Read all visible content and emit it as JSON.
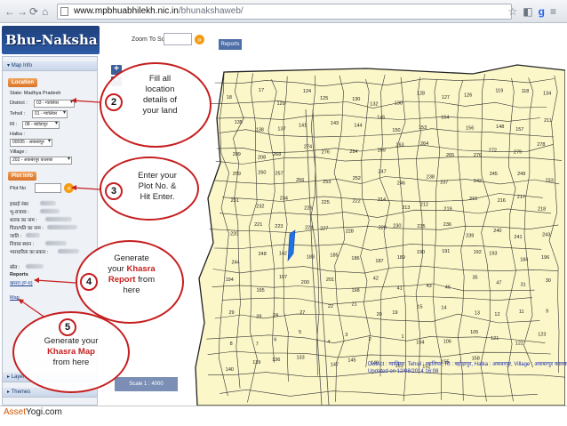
{
  "browser": {
    "url_domain": "www.mpbhuabhilekh.nic.in",
    "url_path": "/bhunakshaweb/",
    "url_prefix": "",
    "back_icon": "back-arrow-icon",
    "forward_icon": "forward-arrow-icon",
    "reload_icon": "reload-icon",
    "home_icon": "home-icon"
  },
  "header": {
    "logo": "Bhu-Naksha",
    "zoom_label": "Zoom To Scale:",
    "reports_label": "Reports"
  },
  "sidebar": {
    "map_info_title": "Map Info",
    "location_tag": "Location",
    "state_label": "State: Madhya Pradesh",
    "district_label": "District :",
    "district_value": "03 - ग्वालियर",
    "tehsil_label": "Tehsil :",
    "tehsil_value": "01 - ग्वालियर",
    "ri_label": "RI :",
    "ri_value": "08 - बहोड़ापुर",
    "halka_label": "Halka :",
    "halka_value": "00095 - अकबरपुर",
    "village_label": "Village :",
    "village_value": "202 - अकबरपुर कालका",
    "plot_info_tag": "Plot Info",
    "plot_no_label": "Plot No",
    "fields": [
      {
        "label": "इकाई नंबर"
      },
      {
        "label": "भू-राजस्व :"
      },
      {
        "label": "धारक का नाम :"
      },
      {
        "label": "पिता/पति का नाम :"
      },
      {
        "label": "जाति :"
      },
      {
        "label": "निवास स्थान :"
      },
      {
        "label": "भारधारिता का प्रकार :"
      }
    ],
    "shrot_label": "स्रोत :",
    "reports_heading": "Reports",
    "khasra_link": "खसरा (P-II)",
    "map_link": "Map",
    "layers_label": "Layers",
    "themes_label": "Themes"
  },
  "map": {
    "zoom_in": "+",
    "zoom_out": "−",
    "scale": "Scale 1 : 4000",
    "info_line1": "District : ग्वालियर, Tehsil : ग्वालियर, RI : बहोड़ापुर, Halka : अकबरपुर, Village : अकबरपुर कालका,",
    "info_line2": "Updated on 12/08/2014 16:08",
    "plot_numbers": [
      "18",
      "17",
      "129",
      "124",
      "125",
      "130",
      "132",
      "130",
      "128",
      "127",
      "126",
      "119",
      "118",
      "134",
      "135",
      "138",
      "137",
      "141",
      "143",
      "144",
      "146",
      "150",
      "153",
      "154",
      "156",
      "148",
      "157",
      "211",
      "209",
      "208",
      "268",
      "274",
      "276",
      "254",
      "269",
      "263",
      "264",
      "265",
      "270",
      "272",
      "279",
      "278",
      "259",
      "260",
      "257",
      "256",
      "253",
      "252",
      "247",
      "246",
      "238",
      "237",
      "242",
      "245",
      "249",
      "233",
      "231",
      "232",
      "234",
      "226",
      "225",
      "222",
      "214",
      "213",
      "212",
      "219",
      "215",
      "216",
      "217",
      "218",
      "220",
      "221",
      "223",
      "224",
      "227",
      "228",
      "229",
      "230",
      "235",
      "236",
      "239",
      "240",
      "241",
      "243",
      "244",
      "248",
      "142",
      "183",
      "185",
      "186",
      "187",
      "189",
      "190",
      "191",
      "192",
      "193",
      "184",
      "196",
      "194",
      "195",
      "197",
      "200",
      "201",
      "198",
      "42",
      "41",
      "43",
      "46",
      "35",
      "47",
      "31",
      "30",
      "29",
      "28",
      "24",
      "27",
      "22",
      "21",
      "20",
      "19",
      "15",
      "14",
      "13",
      "12",
      "11",
      "9",
      "8",
      "7",
      "6",
      "5",
      "4",
      "3",
      "2",
      "1",
      "104",
      "106",
      "105",
      "121",
      "122",
      "123",
      "140",
      "139",
      "136",
      "133",
      "147",
      "145",
      "149",
      "151",
      "152",
      "155",
      "158"
    ]
  },
  "callouts": {
    "c2_num": "2",
    "c2_line1": "Fill all",
    "c2_line2": "location",
    "c2_line3": "details of",
    "c2_line4": "your land",
    "c3_num": "3",
    "c3_line1": "Enter your",
    "c3_line2": "Plot No. &",
    "c3_line3": "Hit Enter.",
    "c4_num": "4",
    "c4_line1": "Generate",
    "c4_line2a": "your ",
    "c4_line2b": "Khasra",
    "c4_line3a": "Report",
    "c4_line3b": " from",
    "c4_line4": "here",
    "c5_num": "5",
    "c5_line1": "Generate your",
    "c5_line2": "Khasra Map",
    "c5_line3": "from here"
  },
  "footer": {
    "brand_a": "Asset",
    "brand_b": "Yogi.com"
  },
  "colors": {
    "accent_red": "#c61f1f",
    "map_fill": "#fbf7c8",
    "parcel_line": "#333333",
    "highlight_plot": "#1e73e8",
    "header_blue": "#1e3f7a"
  }
}
